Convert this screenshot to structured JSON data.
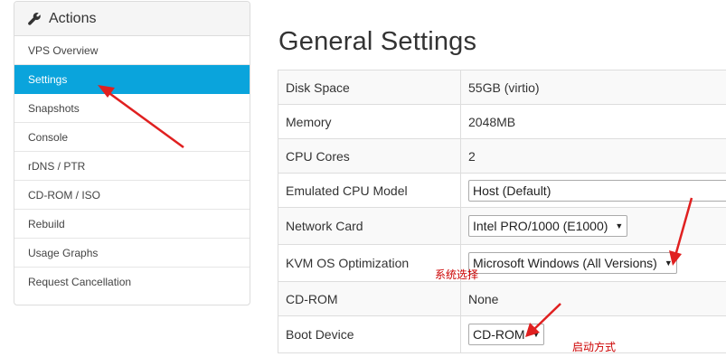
{
  "sidebar": {
    "title": "Actions",
    "items": [
      {
        "label": "VPS Overview",
        "active": false
      },
      {
        "label": "Settings",
        "active": true
      },
      {
        "label": "Snapshots",
        "active": false
      },
      {
        "label": "Console",
        "active": false
      },
      {
        "label": "rDNS / PTR",
        "active": false
      },
      {
        "label": "CD-ROM / ISO",
        "active": false
      },
      {
        "label": "Rebuild",
        "active": false
      },
      {
        "label": "Usage Graphs",
        "active": false
      },
      {
        "label": "Request Cancellation",
        "active": false
      }
    ]
  },
  "main": {
    "title": "General Settings",
    "rows": [
      {
        "label": "Disk Space",
        "value": "55GB (virtio)"
      },
      {
        "label": "Memory",
        "value": "2048MB"
      },
      {
        "label": "CPU Cores",
        "value": "2"
      },
      {
        "label": "Emulated CPU Model",
        "select": "Host (Default)"
      },
      {
        "label": "Network Card",
        "select": "Intel PRO/1000 (E1000)"
      },
      {
        "label": "KVM OS Optimization",
        "select": "Microsoft Windows (All Versions)"
      },
      {
        "label": "CD-ROM",
        "value": "None"
      },
      {
        "label": "Boot Device",
        "select": "CD-ROM"
      }
    ]
  },
  "annotations": {
    "os_select_note": "系统选择",
    "boot_note": "启动方式",
    "arrow_color": "#e02020"
  },
  "colors": {
    "active_item": "#0aa4dc"
  }
}
